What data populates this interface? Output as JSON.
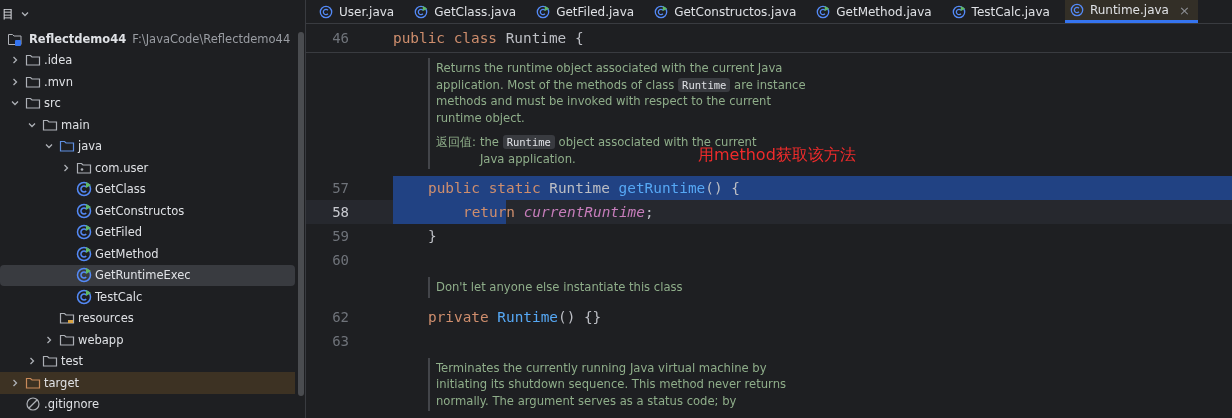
{
  "sidebar": {
    "title": "目",
    "project": {
      "name": "Reflectdemo44",
      "path": "F:\\JavaCode\\Reflectdemo44"
    },
    "tree": [
      {
        "label": ".idea",
        "kind": "folder",
        "expanded": false,
        "selected": false
      },
      {
        "label": ".mvn",
        "kind": "folder",
        "expanded": false,
        "selected": false
      },
      {
        "label": "src",
        "kind": "folder",
        "expanded": true,
        "selected": false,
        "children": [
          {
            "label": "main",
            "kind": "folder",
            "expanded": true,
            "selected": false,
            "children": [
              {
                "label": "java",
                "kind": "source",
                "expanded": true,
                "selected": false,
                "children": [
                  {
                    "label": "com.user",
                    "kind": "package",
                    "expanded": false,
                    "selected": false
                  },
                  {
                    "label": "GetClass",
                    "kind": "class",
                    "selected": false
                  },
                  {
                    "label": "GetConstructos",
                    "kind": "class",
                    "selected": false
                  },
                  {
                    "label": "GetFiled",
                    "kind": "class",
                    "selected": false
                  },
                  {
                    "label": "GetMethod",
                    "kind": "class",
                    "selected": false
                  },
                  {
                    "label": "GetRuntimeExec",
                    "kind": "class",
                    "selected": true
                  },
                  {
                    "label": "TestCalc",
                    "kind": "class",
                    "selected": false
                  }
                ]
              },
              {
                "label": "resources",
                "kind": "resources",
                "selected": false
              },
              {
                "label": "webapp",
                "kind": "folder",
                "expanded": false,
                "selected": false
              }
            ]
          },
          {
            "label": "test",
            "kind": "folder",
            "expanded": false,
            "selected": false
          }
        ]
      },
      {
        "label": "target",
        "kind": "excluded",
        "expanded": false,
        "selected": false
      },
      {
        "label": ".gitignore",
        "kind": "ignore",
        "selected": false
      }
    ]
  },
  "tabs": [
    {
      "label": "User.java",
      "kind": "class",
      "selected": false
    },
    {
      "label": "GetClass.java",
      "kind": "runnable",
      "selected": false
    },
    {
      "label": "GetFiled.java",
      "kind": "runnable",
      "selected": false
    },
    {
      "label": "GetConstructos.java",
      "kind": "runnable",
      "selected": false
    },
    {
      "label": "GetMethod.java",
      "kind": "runnable",
      "selected": false
    },
    {
      "label": "TestCalc.java",
      "kind": "runnable",
      "selected": false
    },
    {
      "label": "Runtime.java",
      "kind": "class",
      "selected": true,
      "close": "×"
    }
  ],
  "editor": {
    "lines": [
      {
        "kind": "code",
        "number": "46",
        "selected": false,
        "current": false,
        "tokens": [
          {
            "text": "public class ",
            "kind": "keyword"
          },
          {
            "text": "Runtime {",
            "kind": "plain"
          }
        ],
        "children": [
          {
            "kind": "doc",
            "annotation": "用method获取该方法",
            "paragraphs": [
              {
                "segments": [
                  {
                    "text": "Returns the runtime object associated with the current Java application. Most of the methods of class ",
                    "kind": "text"
                  },
                  {
                    "text": "Runtime",
                    "kind": "code"
                  },
                  {
                    "text": " are instance methods and must be invoked with respect to the current runtime object.",
                    "kind": "text"
                  }
                ]
              },
              {
                "label": "返回值:",
                "segments": [
                  {
                    "text": "the ",
                    "kind": "text"
                  },
                  {
                    "text": "Runtime",
                    "kind": "code"
                  },
                  {
                    "text": " object associated with the current Java application.",
                    "kind": "text"
                  }
                ]
              }
            ]
          },
          {
            "kind": "code",
            "number": "57",
            "selected": true,
            "current": false,
            "tokens": [
              {
                "text": "public static ",
                "kind": "keyword"
              },
              {
                "text": "Runtime ",
                "kind": "plain"
              },
              {
                "text": "getRuntime",
                "kind": "method"
              },
              {
                "text": "() {",
                "kind": "plain"
              }
            ],
            "children": [
              {
                "kind": "code",
                "number": "58",
                "selected": false,
                "current": true,
                "tokens": [
                  {
                    "text": "retur",
                    "kind": "keyword",
                    "selected": true
                  },
                  {
                    "text": "n ",
                    "kind": "keyword",
                    "selected": false
                  },
                  {
                    "text": "currentRuntime",
                    "kind": "field",
                    "selected": false
                  },
                  {
                    "text": ";",
                    "kind": "plain",
                    "selected": false
                  }
                ]
              }
            ]
          },
          {
            "kind": "code",
            "number": "59",
            "selected": false,
            "current": false,
            "tokens": [
              {
                "text": "}",
                "kind": "plain"
              }
            ]
          },
          {
            "kind": "code",
            "number": "60"
          },
          {
            "kind": "doc",
            "paragraphs": [
              {
                "segments": [
                  {
                    "text": "Don't let anyone else instantiate this class",
                    "kind": "text"
                  }
                ]
              }
            ]
          },
          {
            "kind": "code",
            "number": "62",
            "selected": false,
            "current": false,
            "tokens": [
              {
                "text": "private ",
                "kind": "keyword"
              },
              {
                "text": "Runtime",
                "kind": "method"
              },
              {
                "text": "() {}",
                "kind": "plain"
              }
            ]
          },
          {
            "kind": "code",
            "number": "63"
          },
          {
            "kind": "doc",
            "paragraphs": [
              {
                "segments": [
                  {
                    "text": "Terminates the currently running Java virtual machine by initiating its shutdown sequence. This method never returns normally. The argument serves as a status code; by",
                    "kind": "text"
                  }
                ]
              }
            ]
          }
        ]
      }
    ]
  }
}
